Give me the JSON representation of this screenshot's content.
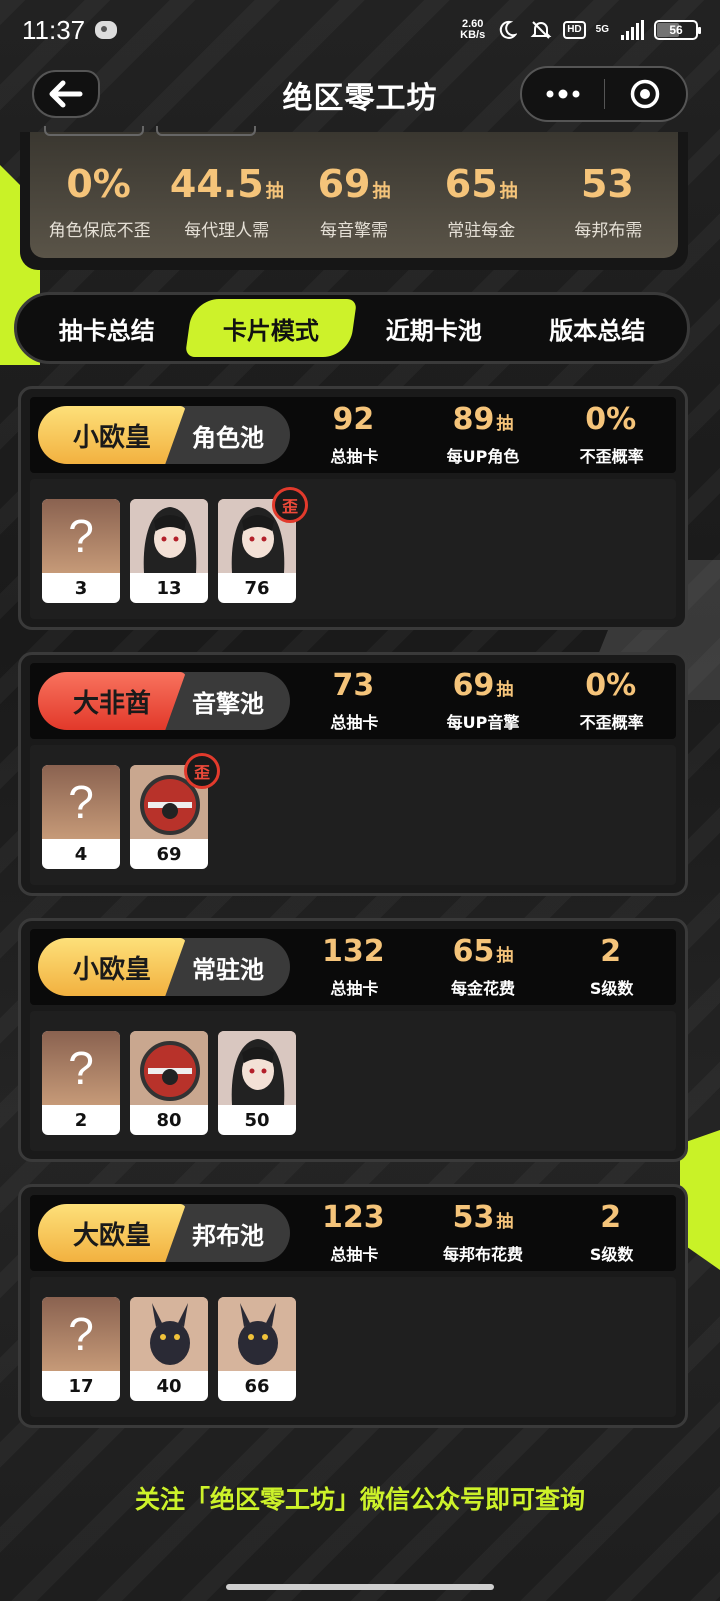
{
  "status_bar": {
    "time": "11:37",
    "net_speed_value": "2.60",
    "net_speed_unit": "KB/s",
    "hd": "HD",
    "network": "5G",
    "battery": "56"
  },
  "header": {
    "title": "绝区零工坊"
  },
  "summary": {
    "stats": [
      {
        "value": "0%",
        "unit": "",
        "label": "角色保底不歪"
      },
      {
        "value": "44.5",
        "unit": "抽",
        "label": "每代理人需"
      },
      {
        "value": "69",
        "unit": "抽",
        "label": "每音擎需"
      },
      {
        "value": "65",
        "unit": "抽",
        "label": "常驻每金"
      },
      {
        "value": "53",
        "unit": "",
        "label": "每邦布需"
      }
    ]
  },
  "tabs": [
    {
      "label": "抽卡总结"
    },
    {
      "label": "卡片模式"
    },
    {
      "label": "近期卡池"
    },
    {
      "label": "版本总结"
    }
  ],
  "pools": [
    {
      "luck": "小欧皇",
      "luck_color": "gold",
      "name": "角色池",
      "stats": [
        {
          "value": "92",
          "unit": "",
          "label": "总抽卡"
        },
        {
          "value": "89",
          "unit": "抽",
          "label": "每UP角色"
        },
        {
          "value": "0%",
          "unit": "",
          "label": "不歪概率"
        }
      ],
      "items": [
        {
          "type": "unknown",
          "symbol": "?",
          "count": "3"
        },
        {
          "type": "agent-portrait",
          "count": "13"
        },
        {
          "type": "agent-portrait",
          "count": "76",
          "badge": "歪"
        }
      ]
    },
    {
      "luck": "大非酋",
      "luck_color": "red",
      "name": "音擎池",
      "stats": [
        {
          "value": "73",
          "unit": "",
          "label": "总抽卡"
        },
        {
          "value": "69",
          "unit": "抽",
          "label": "每UP音擎"
        },
        {
          "value": "0%",
          "unit": "",
          "label": "不歪概率"
        }
      ],
      "items": [
        {
          "type": "unknown",
          "symbol": "?",
          "count": "4"
        },
        {
          "type": "engine-art",
          "count": "69",
          "badge": "歪"
        }
      ]
    },
    {
      "luck": "小欧皇",
      "luck_color": "gold",
      "name": "常驻池",
      "stats": [
        {
          "value": "132",
          "unit": "",
          "label": "总抽卡"
        },
        {
          "value": "65",
          "unit": "抽",
          "label": "每金花费"
        },
        {
          "value": "2",
          "unit": "",
          "label": "S级数"
        }
      ],
      "items": [
        {
          "type": "unknown",
          "symbol": "?",
          "count": "2"
        },
        {
          "type": "engine-art",
          "count": "80"
        },
        {
          "type": "agent-portrait",
          "count": "50"
        }
      ]
    },
    {
      "luck": "大欧皇",
      "luck_color": "gold",
      "name": "邦布池",
      "stats": [
        {
          "value": "123",
          "unit": "",
          "label": "总抽卡"
        },
        {
          "value": "53",
          "unit": "抽",
          "label": "每邦布花费"
        },
        {
          "value": "2",
          "unit": "",
          "label": "S级数"
        }
      ],
      "items": [
        {
          "type": "unknown",
          "symbol": "?",
          "count": "17"
        },
        {
          "type": "bangboo-art",
          "count": "40"
        },
        {
          "type": "bangboo-art",
          "count": "66"
        }
      ]
    }
  ],
  "footer": {
    "note": "关注「绝区零工坊」微信公众号即可查询"
  },
  "colors": {
    "accent_lime": "#cdf22a",
    "stat_gold": "#f5c47a",
    "luck_gold": "#f2b140",
    "luck_red": "#e2392a",
    "badge_red": "#e23a2c"
  }
}
